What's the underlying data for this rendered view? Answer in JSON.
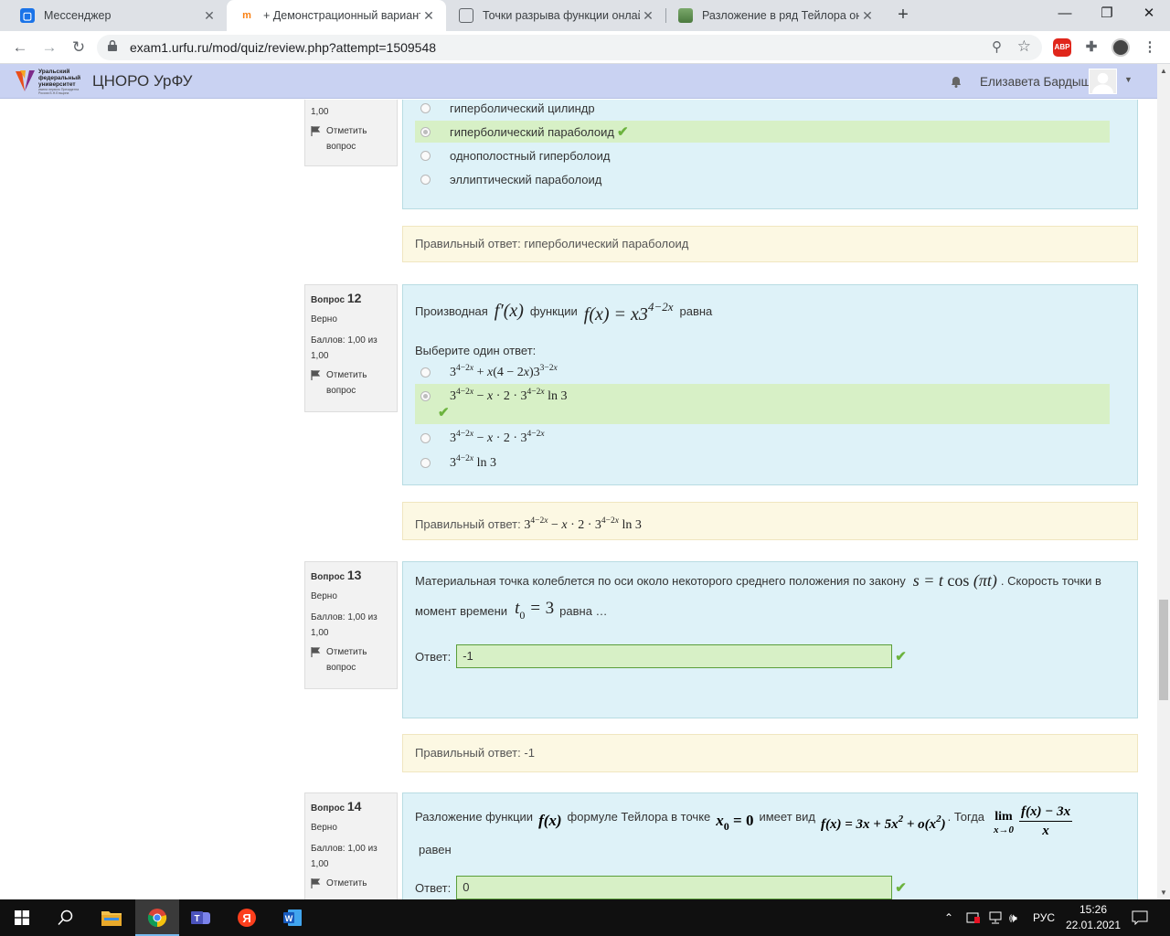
{
  "browser": {
    "tabs": [
      {
        "title": "Мессенджер",
        "active": false
      },
      {
        "title": "+ Демонстрационный вариант",
        "active": true
      },
      {
        "title": "Точки разрыва функции онлайн",
        "active": false
      },
      {
        "title": "Разложение в ряд Тейлора онлайн",
        "active": false
      }
    ],
    "url": "exam1.urfu.ru/mod/quiz/review.php?attempt=1509548",
    "extension_abp": "ABP"
  },
  "site": {
    "logo_line1": "Уральский",
    "logo_line2": "федеральный",
    "logo_line3": "университет",
    "logo_sub": "имени первого Президента России Б.Н.Ельцина",
    "name": "ЦНОРО УрФУ",
    "user_name": "Елизавета Бардыш"
  },
  "q11": {
    "score_tail": "1,00",
    "flag_label_1": "Отметить",
    "flag_label_2": "вопрос",
    "options": [
      {
        "text": "гиперболический цилиндр",
        "selected": false,
        "correct": false
      },
      {
        "text": "гиперболический параболоид",
        "selected": true,
        "correct": true
      },
      {
        "text": "однополостный гиперболоид",
        "selected": false,
        "correct": false
      },
      {
        "text": "эллиптический параболоид",
        "selected": false,
        "correct": false
      }
    ],
    "feedback": "Правильный ответ: гиперболический параболоид"
  },
  "q12": {
    "label": "Вопрос",
    "number": "12",
    "state": "Верно",
    "score_1": "Баллов: 1,00 из",
    "score_2": "1,00",
    "flag_label_1": "Отметить",
    "flag_label_2": "вопрос",
    "text_before": "Производная",
    "text_mid": "функции",
    "text_after": "равна",
    "prompt": "Выберите один ответ:",
    "feedback_prefix": "Правильный ответ:"
  },
  "q13": {
    "label": "Вопрос",
    "number": "13",
    "state": "Верно",
    "score_1": "Баллов: 1,00 из",
    "score_2": "1,00",
    "flag_label_1": "Отметить",
    "flag_label_2": "вопрос",
    "text_1": "Материальная точка колеблется по оси около некоторого среднего положения по закону",
    "text_2": ". Скорость точки в",
    "text_3": "момент времени",
    "text_4": "равна …",
    "answer_label": "Ответ:",
    "answer_value": "-1",
    "feedback": "Правильный ответ: -1"
  },
  "q14": {
    "label": "Вопрос",
    "number": "14",
    "state": "Верно",
    "score_1": "Баллов: 1,00 из",
    "score_2": "1,00",
    "flag_label_1": "Отметить",
    "text_1": "Разложение функции",
    "text_2": "формуле Тейлора в точке",
    "text_3": "имеет вид",
    "text_4": ". Тогда",
    "text_5": "равен",
    "answer_label": "Ответ:",
    "answer_value": "0"
  },
  "taskbar": {
    "lang": "РУС",
    "time": "15:26",
    "date": "22.01.2021"
  },
  "colors": {
    "question_bg": "#def2f8",
    "feedback_bg": "#fcf8e3",
    "correct_bg": "#d7f0c6",
    "header_bg": "#c9d2f2",
    "check": "#6cb33e"
  }
}
